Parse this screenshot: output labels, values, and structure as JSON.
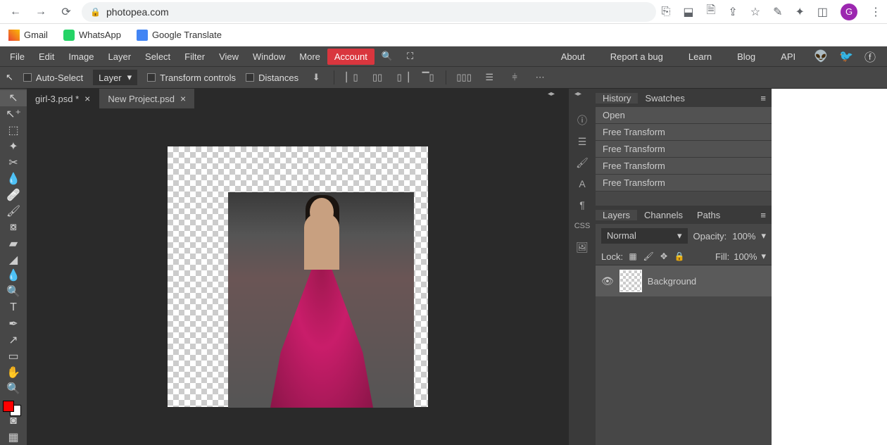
{
  "url": "photopea.com",
  "bookmarks": [
    {
      "label": "Gmail"
    },
    {
      "label": "WhatsApp"
    },
    {
      "label": "Google Translate"
    }
  ],
  "avatar_letter": "G",
  "menu": [
    "File",
    "Edit",
    "Image",
    "Layer",
    "Select",
    "Filter",
    "View",
    "Window",
    "More"
  ],
  "account": "Account",
  "menu_right": [
    "About",
    "Report a bug",
    "Learn",
    "Blog",
    "API"
  ],
  "options": {
    "auto_select": "Auto-Select",
    "layer_dd": "Layer",
    "transform": "Transform controls",
    "distances": "Distances"
  },
  "tabs": [
    {
      "label": "girl-3.psd *",
      "active": true
    },
    {
      "label": "New Project.psd",
      "active": false
    }
  ],
  "history": {
    "tab1": "History",
    "tab2": "Swatches",
    "items": [
      "Open",
      "Free Transform",
      "Free Transform",
      "Free Transform",
      "Free Transform"
    ]
  },
  "layers_panel": {
    "tab1": "Layers",
    "tab2": "Channels",
    "tab3": "Paths",
    "blend": "Normal",
    "opacity_lbl": "Opacity:",
    "opacity": "100%",
    "lock_lbl": "Lock:",
    "fill_lbl": "Fill:",
    "fill": "100%",
    "layer_name": "Background"
  },
  "css_label": "CSS"
}
